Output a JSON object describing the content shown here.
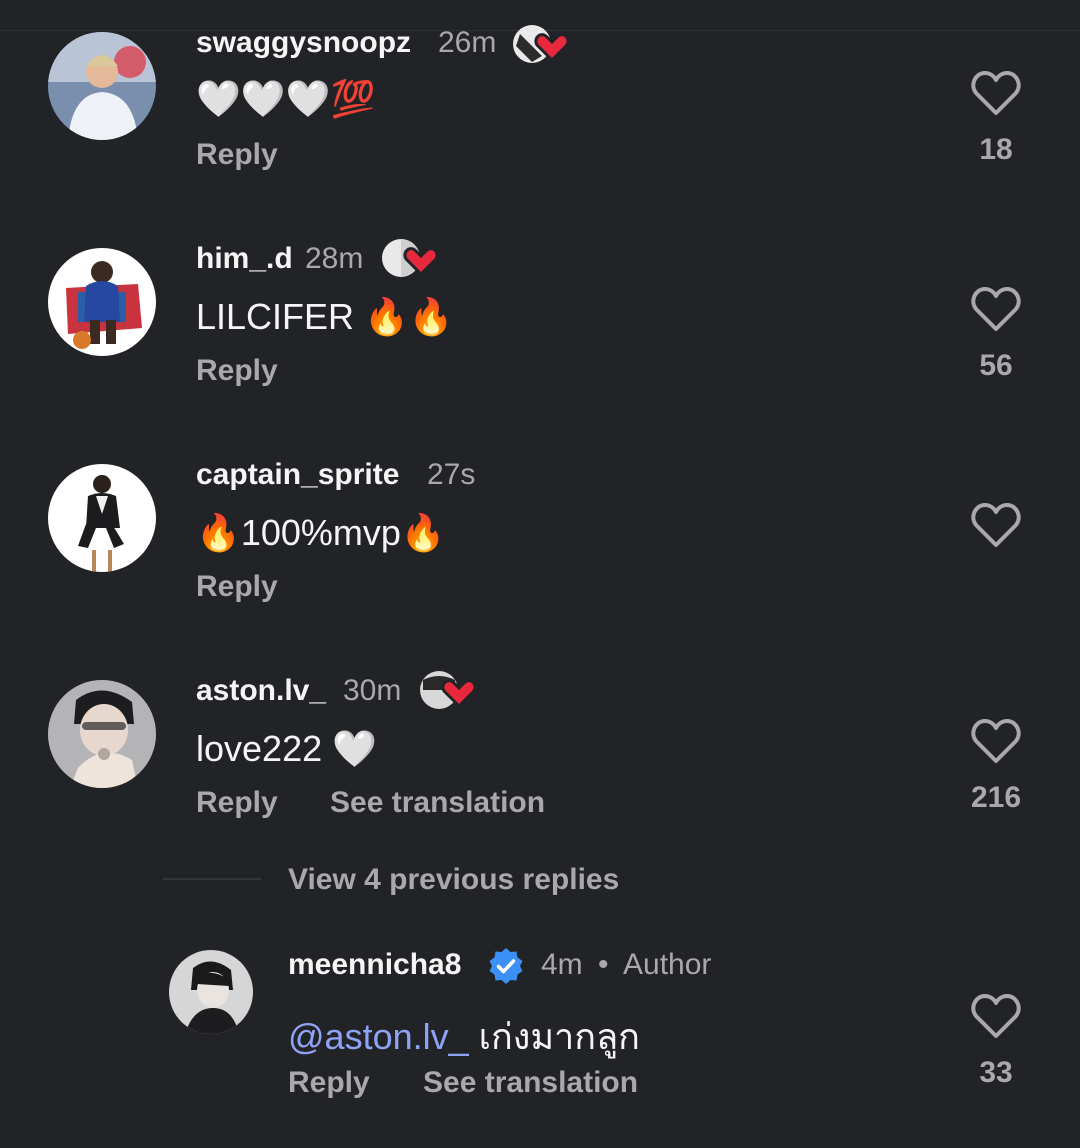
{
  "colors": {
    "background": "#222327",
    "primary_text": "#f5f5f5",
    "secondary_text": "#a8a8ad",
    "mention": "#8fa3f5",
    "verified": "#3b8ff5",
    "heart_red": "#e8283d"
  },
  "comments": [
    {
      "username": "swaggysnoopz",
      "time": "26m",
      "text": "🤍🤍🤍💯",
      "reply_label": "Reply",
      "likes": "18",
      "author_liked": true
    },
    {
      "username": "him_.d",
      "time": "28m",
      "text": "LILCIFER 🔥🔥",
      "reply_label": "Reply",
      "likes": "56",
      "author_liked": true
    },
    {
      "username": "captain_sprite",
      "time": "27s",
      "text": "🔥100%mvp🔥",
      "reply_label": "Reply",
      "likes": "",
      "author_liked": false
    },
    {
      "username": "aston.lv_",
      "time": "30m",
      "text": "love222 🤍",
      "reply_label": "Reply",
      "translate_label": "See translation",
      "likes": "216",
      "author_liked": true
    }
  ],
  "view_replies_label": "View 4 previous replies",
  "reply": {
    "username": "meennicha8",
    "verified_icon": "verified-badge-icon",
    "time": "4m",
    "separator": "•",
    "author_label": "Author",
    "mention": "@aston.lv_",
    "text": " เก่งมากลูก",
    "reply_label": "Reply",
    "translate_label": "See translation",
    "likes": "33"
  }
}
